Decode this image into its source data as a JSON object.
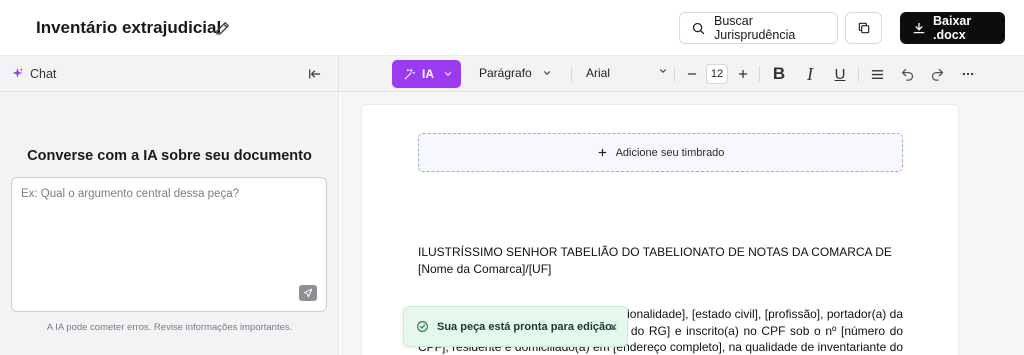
{
  "header": {
    "doc_title": "Inventário extrajudicial",
    "search_label": "Buscar Jurisprudência",
    "download_label": "Baixar .docx"
  },
  "chat": {
    "tab_label": "Chat",
    "heading": "Converse com a IA sobre seu documento",
    "input_placeholder": "Ex: Qual o argumento central dessa peça?",
    "disclaimer": "A IA pode cometer erros. Revise informações importantes."
  },
  "toolbar": {
    "ia_label": "IA",
    "paragraph_style": "Parágrafo",
    "font_family": "Arial",
    "font_size": "12",
    "bold": "B",
    "italic": "I",
    "underline": "U"
  },
  "document": {
    "letterhead_label": "Adicione seu timbrado",
    "para1": "ILUSTRÍSSIMO SENHOR TABELIÃO DO TABELIONATO DE NOTAS DA COMARCA DE [Nome da Comarca]/[UF]",
    "para2": "[Nome completo do inventariante], [nacionalidade], [estado civil], [profissão], portador(a) da Carteira de Identidade RG nº [número do RG] e inscrito(a) no CPF sob o nº [número do CPF], residente e domiciliado(a) em [endereço completo], na qualidade de inventariante do espólio de [Nome do Falecido], falecido em [Data do Óbito], vem"
  },
  "toast": {
    "message": "Sua peça está pronta para edição.",
    "close": "×"
  },
  "colors": {
    "accent": "#9b3bf0",
    "download_bg": "#0d0d0d",
    "toast_bg": "#e6f7ec"
  }
}
